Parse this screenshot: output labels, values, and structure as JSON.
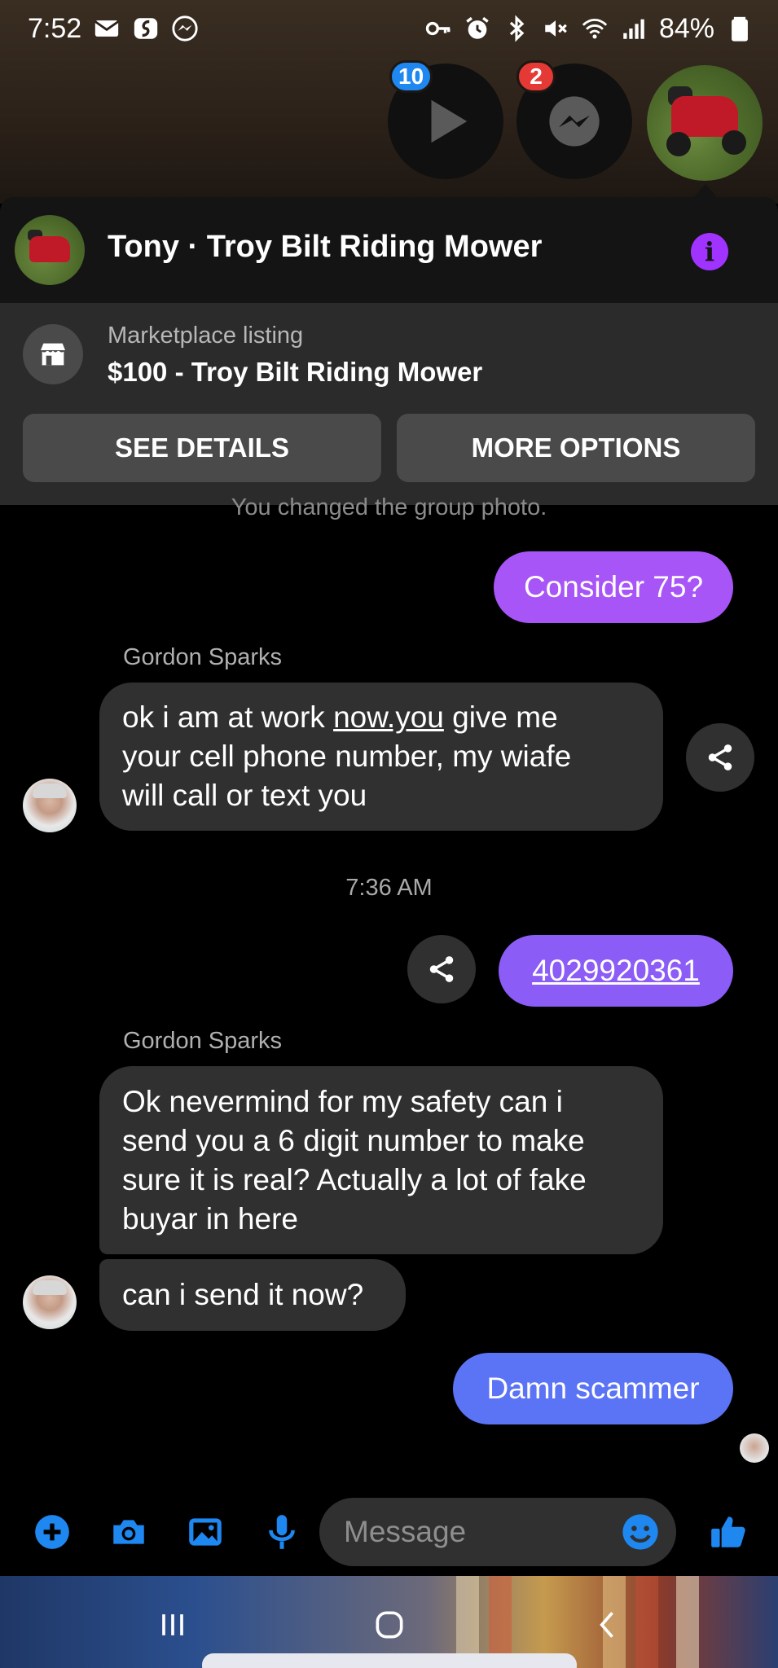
{
  "status_bar": {
    "time": "7:52",
    "battery": "84%",
    "left_icons": [
      "mail-icon",
      "swipe-app-icon",
      "messenger-notification-icon"
    ],
    "right_icons": [
      "vpn-key-icon",
      "alarm-icon",
      "bluetooth-icon",
      "mute-icon",
      "wifi-icon",
      "signal-icon",
      "battery-icon"
    ]
  },
  "chat_heads": {
    "video_badge": "10",
    "messenger_badge": "2"
  },
  "header": {
    "title": "Tony · Troy Bilt Riding Mower",
    "info_icon": "info-icon"
  },
  "listing": {
    "caption": "Marketplace listing",
    "title": "$100 - Troy Bilt Riding Mower",
    "see_details": "SEE DETAILS",
    "more_options": "MORE OPTIONS"
  },
  "messages": {
    "system_note": "You changed the group photo.",
    "out_1": "Consider 75?",
    "sender_1": "Gordon Sparks",
    "in_1_part1": "ok i am at work ",
    "in_1_link": "now.you",
    "in_1_part2": " give me",
    "in_1_line2": "your cell phone number, my wiafe",
    "in_1_line3": "will call or text you",
    "time_1": "7:36 AM",
    "out_2": "4029920361",
    "sender_2": "Gordon Sparks",
    "in_2_line1": "Ok nevermind for my safety can i",
    "in_2_line2": "send you a 6 digit number to make",
    "in_2_line3": "sure it is real? Actually a lot of fake",
    "in_2_line4": "buyar in here",
    "in_3": "can i send it now?",
    "out_3": "Damn scammer"
  },
  "composer": {
    "placeholder": "Message",
    "icons": [
      "plus-icon",
      "camera-icon",
      "gallery-icon",
      "microphone-icon",
      "emoji-icon",
      "thumbs-up-icon"
    ]
  },
  "colors": {
    "accent": "#1e87f0",
    "purple": "#a033ff",
    "bubble_out_purple": "#a855f7",
    "bubble_out_violet": "#8b5cf6",
    "bubble_out_blue": "#5b73f5",
    "bubble_in": "#303030",
    "badge_blue": "#1e87f0",
    "badge_red": "#e53935"
  }
}
